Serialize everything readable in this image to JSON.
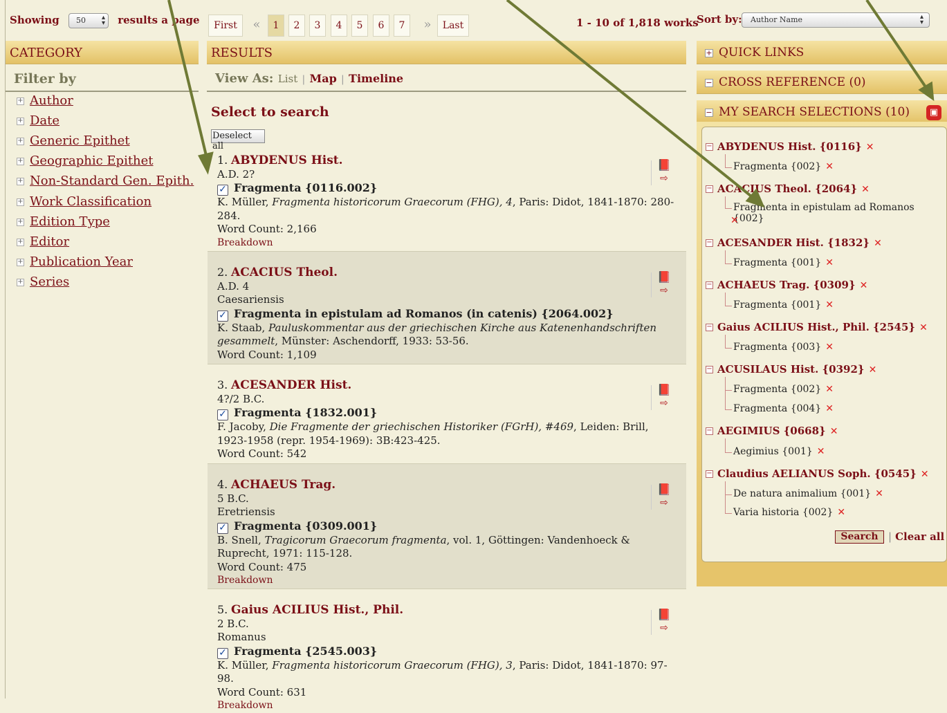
{
  "top": {
    "showing_label": "Showing",
    "per_page": "50",
    "per_page_suffix": "results a page",
    "pager": {
      "first": "First",
      "prev": "«",
      "pages": [
        "1",
        "2",
        "3",
        "4",
        "5",
        "6",
        "7"
      ],
      "next": "»",
      "last": "Last",
      "current": "1"
    },
    "count_text": "1 - 10 of 1,818 works",
    "sort_label": "Sort by:",
    "sort_value": "Author Name"
  },
  "sidebar": {
    "header": "CATEGORY",
    "filter_label": "Filter by",
    "items": [
      "Author",
      "Date",
      "Generic Epithet",
      "Geographic Epithet",
      "Non-Standard Gen. Epith.",
      "Work Classification",
      "Edition Type",
      "Editor",
      "Publication Year",
      "Series"
    ]
  },
  "results": {
    "header": "RESULTS",
    "view_as_label": "View As:",
    "views": [
      "List",
      "Map",
      "Timeline"
    ],
    "select_to_search": "Select to search",
    "deselect_all": "Deselect all",
    "word_count_label": "Word Count:",
    "breakdown_label": "Breakdown",
    "items": [
      {
        "num": "1.",
        "author": "ABYDENUS Hist.",
        "date": "A.D. 2?",
        "place": "",
        "work": "Fragmenta {0116.002}",
        "ed_pre": "K. Müller, ",
        "ed_title": "Fragmenta historicorum Graecorum (FHG), 4",
        "ed_post": ", Paris: Didot, 1841-1870: 280-284.",
        "words": "2,166",
        "breakdown": true
      },
      {
        "num": "2.",
        "author": "ACACIUS Theol.",
        "date": "A.D. 4",
        "place": "Caesariensis",
        "work": "Fragmenta in epistulam ad Romanos (in catenis) {2064.002}",
        "ed_pre": "K. Staab, ",
        "ed_title": "Pauluskommentar aus der griechischen Kirche aus Katenenhandschriften gesammelt",
        "ed_post": ", Münster: Aschendorff, 1933: 53-56.",
        "words": "1,109",
        "breakdown": false
      },
      {
        "num": "3.",
        "author": "ACESANDER Hist.",
        "date": "4?/2 B.C.",
        "place": "",
        "work": "Fragmenta {1832.001}",
        "ed_pre": "F. Jacoby, ",
        "ed_title": "Die Fragmente der griechischen Historiker (FGrH), #469",
        "ed_post": ", Leiden: Brill, 1923-1958 (repr. 1954-1969): 3B:423-425.",
        "words": "542",
        "breakdown": false
      },
      {
        "num": "4.",
        "author": "ACHAEUS Trag.",
        "date": "5 B.C.",
        "place": "Eretriensis",
        "work": "Fragmenta {0309.001}",
        "ed_pre": "B. Snell, ",
        "ed_title": "Tragicorum Graecorum fragmenta",
        "ed_post": ", vol. 1, Göttingen: Vandenhoeck & Ruprecht, 1971: 115-128.",
        "words": "475",
        "breakdown": true
      },
      {
        "num": "5.",
        "author": "Gaius ACILIUS Hist., Phil.",
        "date": "2 B.C.",
        "place": "Romanus",
        "work": "Fragmenta {2545.003}",
        "ed_pre": "K. Müller, ",
        "ed_title": "Fragmenta historicorum Graecorum (FHG), 3",
        "ed_post": ", Paris: Didot, 1841-1870: 97-98.",
        "words": "631",
        "breakdown": true
      }
    ]
  },
  "right": {
    "quick_links": "QUICK LINKS",
    "cross_reference": "CROSS REFERENCE (0)",
    "my_selections": "MY SEARCH SELECTIONS (10)",
    "save_icon_name": "save-icon",
    "tree": [
      {
        "author": "ABYDENUS Hist. {0116}",
        "works": [
          "Fragmenta {002}"
        ]
      },
      {
        "author": "ACACIUS Theol. {2064}",
        "works": [
          "Fragmenta in epistulam ad Romanos {002}"
        ]
      },
      {
        "author": "ACESANDER Hist. {1832}",
        "works": [
          "Fragmenta {001}"
        ]
      },
      {
        "author": "ACHAEUS Trag. {0309}",
        "works": [
          "Fragmenta {001}"
        ]
      },
      {
        "author": "Gaius ACILIUS Hist., Phil. {2545}",
        "works": [
          "Fragmenta {003}"
        ]
      },
      {
        "author": "ACUSILAUS Hist. {0392}",
        "works": [
          "Fragmenta {002}",
          "Fragmenta {004}"
        ]
      },
      {
        "author": "AEGIMIUS {0668}",
        "works": [
          "Aegimius {001}"
        ]
      },
      {
        "author": "Claudius AELIANUS Soph. {0545}",
        "works": [
          "De natura animalium {001}",
          "Varia historia {002}"
        ]
      }
    ],
    "search_button": "Search",
    "clear_all": "Clear all"
  },
  "colors": {
    "accent": "#7b0f17",
    "bar": "#e8c870",
    "background": "#f3f0dc",
    "arrow": "#6f7a35"
  }
}
